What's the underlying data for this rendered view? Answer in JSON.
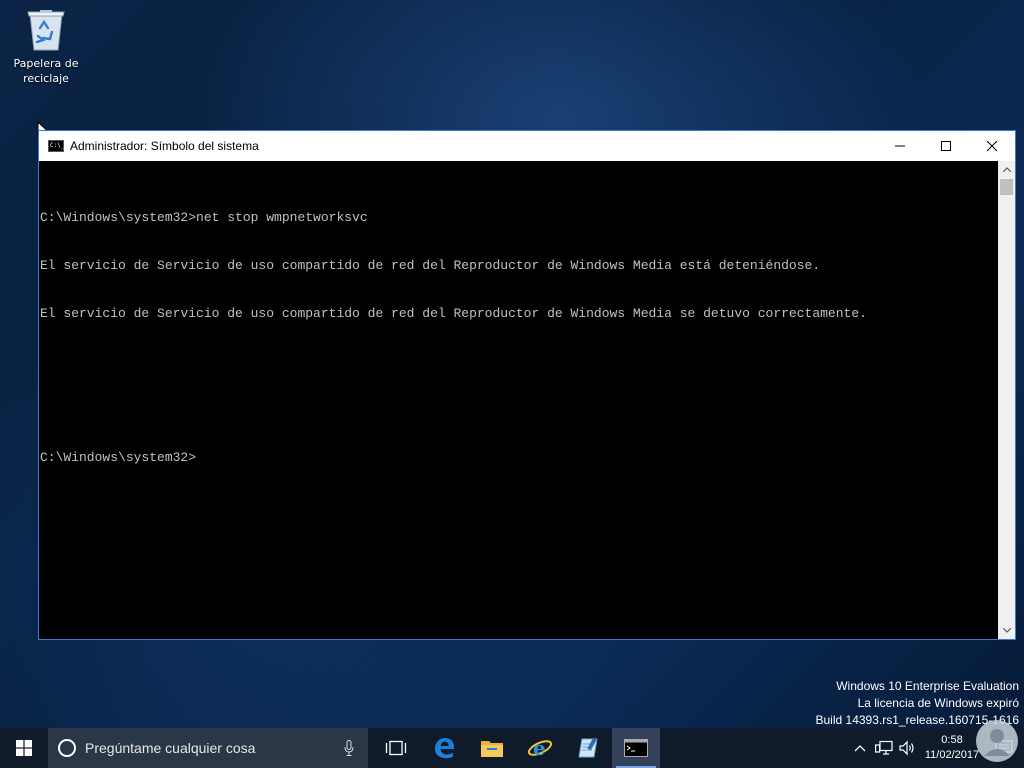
{
  "desktop": {
    "recycle_bin": {
      "label": "Papelera de reciclaje"
    }
  },
  "window": {
    "title": "Administrador: Símbolo del sistema",
    "icon_text": "C:\\_",
    "console_lines": [
      "C:\\Windows\\system32>net stop wmpnetworksvc",
      "El servicio de Servicio de uso compartido de red del Reproductor de Windows Media está deteniéndose.",
      "El servicio de Servicio de uso compartido de red del Reproductor de Windows Media se detuvo correctamente.",
      "",
      "",
      "C:\\Windows\\system32>"
    ]
  },
  "watermark": {
    "line1": "Windows 10 Enterprise Evaluation",
    "line2": "La licencia de Windows expiró",
    "line3": "Build 14393.rs1_release.160715-1616"
  },
  "taskbar": {
    "search_placeholder": "Pregúntame cualquier cosa",
    "apps": [
      "task-view",
      "edge",
      "file-explorer",
      "internet-explorer",
      "notepad",
      "command-prompt"
    ],
    "clock": {
      "time": "0:58",
      "date": "11/02/2017"
    }
  },
  "colors": {
    "console_bg": "#000000",
    "console_text": "#c0c0c0",
    "window_border": "#3a7bd5",
    "taskbar_bg": "#0f1b2b",
    "search_bg": "#2b3747"
  }
}
